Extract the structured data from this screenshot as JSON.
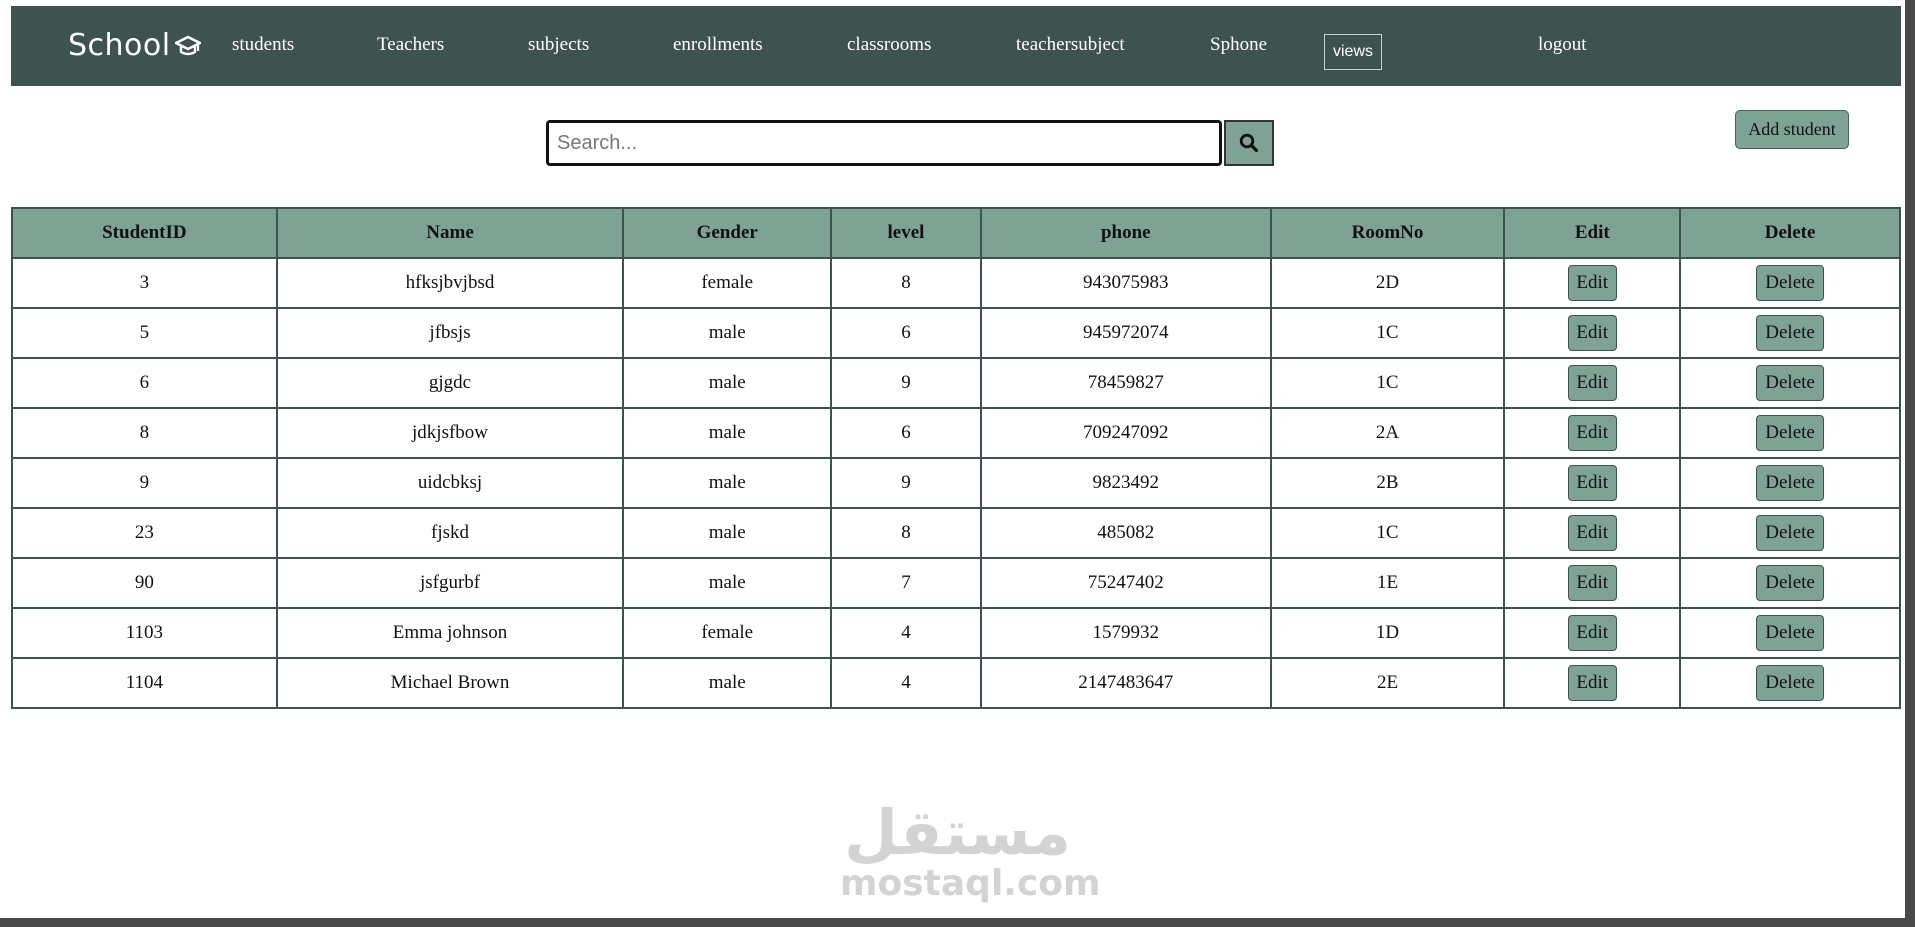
{
  "nav": {
    "logo_text": "School",
    "links": [
      "students",
      "Teachers",
      "subjects",
      "enrollments",
      "classrooms",
      "teachersubject",
      "Sphone"
    ],
    "views_label": "views",
    "logout_label": "logout"
  },
  "search": {
    "placeholder": "Search...",
    "value": ""
  },
  "add_student_label": "Add student",
  "table": {
    "headers": [
      "StudentID",
      "Name",
      "Gender",
      "level",
      "phone",
      "RoomNo",
      "Edit",
      "Delete"
    ],
    "edit_label": "Edit",
    "delete_label": "Delete",
    "rows": [
      {
        "id": "3",
        "name": "hfksjbvjbsd",
        "gender": "female",
        "level": "8",
        "phone": "943075983",
        "room": "2D"
      },
      {
        "id": "5",
        "name": "jfbsjs",
        "gender": "male",
        "level": "6",
        "phone": "945972074",
        "room": "1C"
      },
      {
        "id": "6",
        "name": "gjgdc",
        "gender": "male",
        "level": "9",
        "phone": "78459827",
        "room": "1C"
      },
      {
        "id": "8",
        "name": "jdkjsfbow",
        "gender": "male",
        "level": "6",
        "phone": "709247092",
        "room": "2A"
      },
      {
        "id": "9",
        "name": "uidcbksj",
        "gender": "male",
        "level": "9",
        "phone": "9823492",
        "room": "2B"
      },
      {
        "id": "23",
        "name": "fjskd",
        "gender": "male",
        "level": "8",
        "phone": "485082",
        "room": "1C"
      },
      {
        "id": "90",
        "name": "jsfgurbf",
        "gender": "male",
        "level": "7",
        "phone": "75247402",
        "room": "1E"
      },
      {
        "id": "1103",
        "name": "Emma johnson",
        "gender": "female",
        "level": "4",
        "phone": "1579932",
        "room": "1D"
      },
      {
        "id": "1104",
        "name": "Michael Brown",
        "gender": "male",
        "level": "4",
        "phone": "2147483647",
        "room": "2E"
      }
    ]
  },
  "watermark": {
    "arabic": "مستقل",
    "latin": "mostaql.com"
  },
  "colors": {
    "navbar": "#3e5250",
    "accent": "#7ea293"
  },
  "icons": {
    "logo": "graduation-cap-icon",
    "search": "search-icon"
  }
}
